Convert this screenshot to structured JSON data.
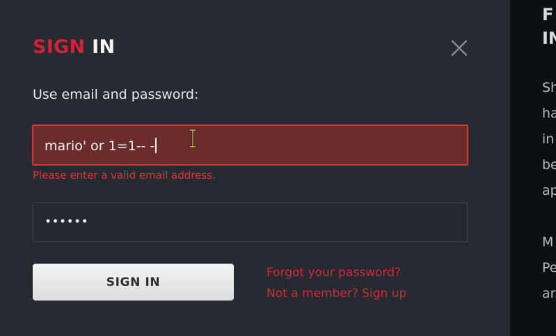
{
  "modal": {
    "title_accent": "SIGN",
    "title_main": "IN",
    "close_icon": "close-icon",
    "instruction": "Use email and password:",
    "email_value": "mario' or 1=1-- -",
    "email_error": "Please enter a valid email address.",
    "password_value": "••••••",
    "signin_label": "SIGN IN",
    "forgot_link": "Forgot your password?",
    "signup_link": "Not a member? Sign up"
  },
  "background_page": {
    "heading_lines": [
      "F",
      "IN"
    ],
    "text_lines": [
      "Sh",
      "ha",
      "in",
      "be",
      "ap",
      "M",
      "Pe",
      "ar"
    ]
  },
  "colors": {
    "accent": "#d7203a",
    "error": "#d73a35",
    "modal_bg": "#272a31",
    "error_field_bg": "#6a2d2c"
  }
}
